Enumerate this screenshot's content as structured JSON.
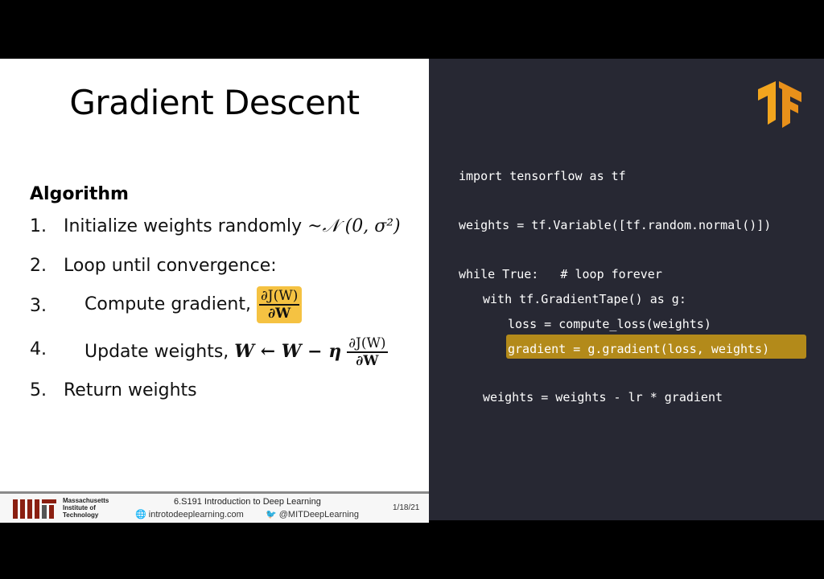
{
  "slide": {
    "title": "Gradient Descent",
    "algorithm_heading": "Algorithm",
    "steps": [
      {
        "num": "1.",
        "text": "Initialize weights randomly ",
        "math": "~𝒩 (0, σ²)"
      },
      {
        "num": "2.",
        "text": "Loop until convergence:"
      },
      {
        "num": "3.",
        "text": "Compute gradient, ",
        "frac_top": "∂J(W)",
        "frac_bot": "∂W"
      },
      {
        "num": "4.",
        "text": "Update weights, ",
        "math": "W ← W − η",
        "frac_top": "∂J(W)",
        "frac_bot": "∂W"
      },
      {
        "num": "5.",
        "text": "Return weights"
      }
    ],
    "footer": {
      "mit_name": "Massachusetts Institute of Technology",
      "course": "6.S191 Introduction to Deep Learning",
      "website": "introtodeeplearning.com",
      "twitter": "@MITDeepLearning",
      "date": "1/18/21"
    }
  },
  "code": {
    "lines": [
      "import tensorflow as tf",
      "weights = tf.Variable([tf.random.normal()])",
      "while True:   # loop forever",
      "with tf.GradientTape() as g:",
      "loss = compute_loss(weights)",
      "gradient = g.gradient(loss, weights)",
      "weights = weights - lr * gradient"
    ]
  },
  "colors": {
    "highlight_box": "#f5c242",
    "code_bg": "#272833",
    "code_highlight": "#b38a1a",
    "tf_logo": "#f2a51e"
  },
  "icons": [
    "mit-logo",
    "globe-icon",
    "twitter-icon",
    "tensorflow-logo"
  ]
}
